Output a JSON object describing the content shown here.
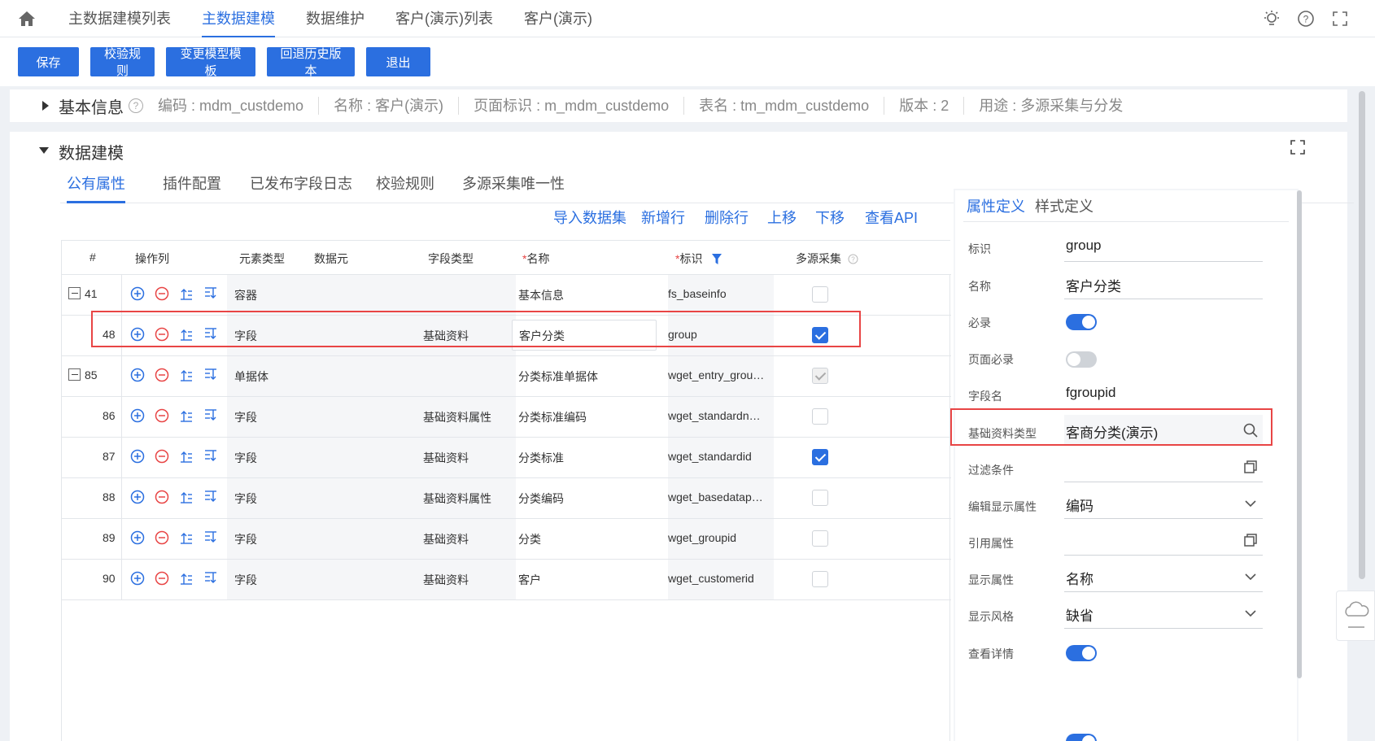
{
  "nav": {
    "tabs": [
      "主数据建模列表",
      "主数据建模",
      "数据维护",
      "客户(演示)列表",
      "客户(演示)"
    ],
    "active_index": 1
  },
  "toolbar": {
    "save": "保存",
    "validate_rules": "校验规则",
    "change_template": "变更模型模板",
    "rollback": "回退历史版本",
    "exit": "退出"
  },
  "basic_info": {
    "title": "基本信息",
    "help": "?",
    "code": "编码 : mdm_custdemo",
    "name": "名称 : 客户(演示)",
    "page_id": "页面标识 : m_mdm_custdemo",
    "table": "表名 : tm_mdm_custdemo",
    "version": "版本 : 2",
    "usage": "用途 : 多源采集与分发"
  },
  "model": {
    "title": "数据建模",
    "tabs": [
      "公有属性",
      "插件配置",
      "已发布字段日志",
      "校验规则",
      "多源采集唯一性"
    ],
    "actions": [
      "导入数据集",
      "新增行",
      "删除行",
      "上移",
      "下移",
      "查看API"
    ],
    "grid": {
      "headers": {
        "idx": "#",
        "ops": "操作列",
        "element_type": "元素类型",
        "data_element": "数据元",
        "field_type": "字段类型",
        "name_req": "*",
        "name": "名称",
        "key_req": "*",
        "key": "标识",
        "multi_source": "多源采集"
      },
      "rows": [
        {
          "idx": "41",
          "collapsible": true,
          "element_type": "容器",
          "field_type": "",
          "name": "基本信息",
          "key": "fs_baseinfo",
          "check": "off"
        },
        {
          "idx": "48",
          "collapsible": false,
          "element_type": "字段",
          "field_type": "基础资料",
          "name": "客户分类",
          "key": "group",
          "check": "on"
        },
        {
          "idx": "85",
          "collapsible": true,
          "element_type": "单据体",
          "field_type": "",
          "name": "分类标准单据体",
          "key": "wget_entry_grou…",
          "check": "dim"
        },
        {
          "idx": "86",
          "collapsible": false,
          "element_type": "字段",
          "field_type": "基础资料属性",
          "name": "分类标准编码",
          "key": "wget_standardn…",
          "check": "off"
        },
        {
          "idx": "87",
          "collapsible": false,
          "element_type": "字段",
          "field_type": "基础资料",
          "name": "分类标准",
          "key": "wget_standardid",
          "check": "on"
        },
        {
          "idx": "88",
          "collapsible": false,
          "element_type": "字段",
          "field_type": "基础资料属性",
          "name": "分类编码",
          "key": "wget_basedatap…",
          "check": "off"
        },
        {
          "idx": "89",
          "collapsible": false,
          "element_type": "字段",
          "field_type": "基础资料",
          "name": "分类",
          "key": "wget_groupid",
          "check": "off"
        },
        {
          "idx": "90",
          "collapsible": false,
          "element_type": "字段",
          "field_type": "基础资料",
          "name": "客户",
          "key": "wget_customerid",
          "check": "off"
        }
      ]
    }
  },
  "props": {
    "tabs": [
      "属性定义",
      "样式定义"
    ],
    "items": {
      "key_label": "标识",
      "key_value": "group",
      "name_label": "名称",
      "name_value": "客户分类",
      "required_label": "必录",
      "page_required_label": "页面必录",
      "field_name_label": "字段名",
      "field_name_value": "fgroupid",
      "basedata_type_label": "基础资料类型",
      "basedata_type_value": "客商分类(演示)",
      "filter_label": "过滤条件",
      "filter_value": "",
      "edit_display_label": "编辑显示属性",
      "edit_display_value": "编码",
      "ref_attr_label": "引用属性",
      "ref_attr_value": "",
      "display_attr_label": "显示属性",
      "display_attr_value": "名称",
      "display_style_label": "显示风格",
      "display_style_value": "缺省",
      "view_detail_label": "查看详情"
    },
    "toggles": {
      "required": true,
      "page_required": false,
      "view_detail": true
    }
  },
  "colors": {
    "accent": "#2b6fe0",
    "highlight": "#e84545"
  }
}
